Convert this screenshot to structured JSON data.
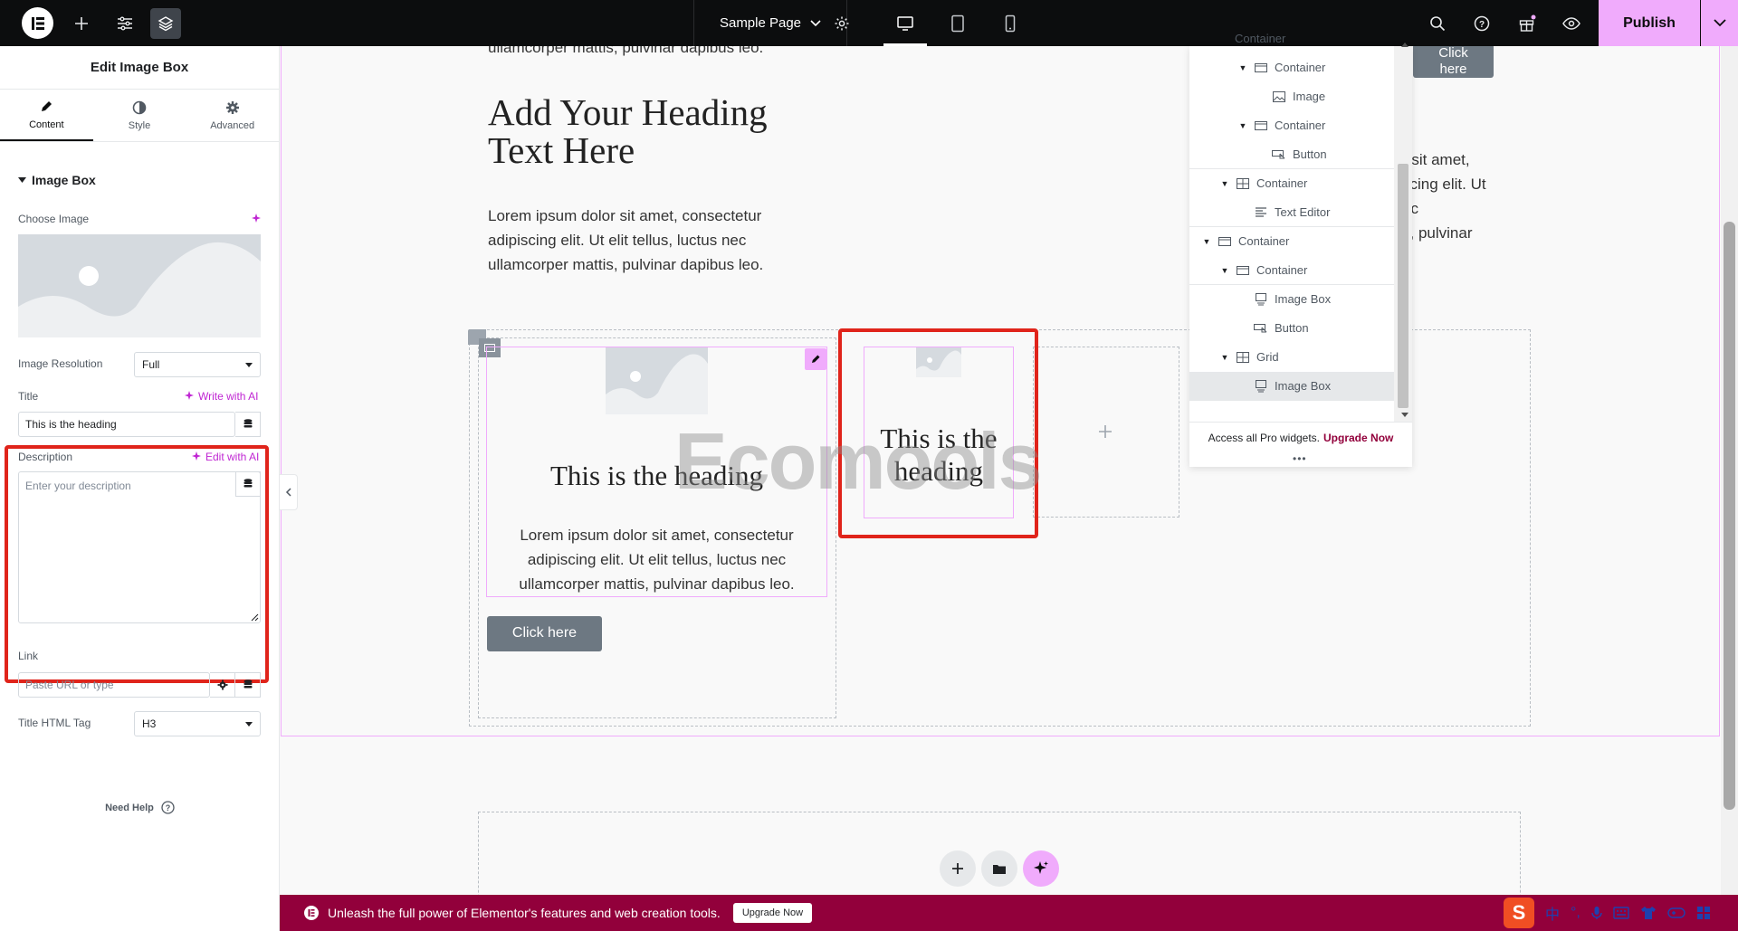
{
  "topbar": {
    "page_title": "Sample Page",
    "publish_label": "Publish"
  },
  "panel": {
    "title": "Edit Image Box",
    "tabs": [
      {
        "label": "Content",
        "icon": "pencil-icon",
        "active": true
      },
      {
        "label": "Style",
        "icon": "contrast-icon",
        "active": false
      },
      {
        "label": "Advanced",
        "icon": "gear-icon",
        "active": false
      }
    ],
    "section_title": "Image Box",
    "choose_image_label": "Choose Image",
    "image_resolution_label": "Image Resolution",
    "image_resolution_value": "Full",
    "title_label": "Title",
    "write_ai_label": "Write with AI",
    "title_value": "This is the heading",
    "description_label": "Description",
    "edit_ai_label": "Edit with AI",
    "description_placeholder": "Enter your description",
    "link_label": "Link",
    "link_placeholder": "Paste URL or type",
    "title_tag_label": "Title HTML Tag",
    "title_tag_value": "H3",
    "need_help_label": "Need Help"
  },
  "canvas": {
    "top_partial_text": "ullamcorper mattis, pulvinar dapibus leo.",
    "heading": "Add Your Heading Text Here",
    "heading_line1": "Add Your Heading",
    "heading_line2": "Text Here",
    "paragraph_lines": [
      "Lorem ipsum dolor sit amet, consectetur",
      "adipiscing elit. Ut elit tellus, luctus nec",
      "ullamcorper mattis, pulvinar dapibus leo."
    ],
    "right_paragraph_lines": [
      "r sit amet,",
      "scing elit. Ut",
      "ec",
      "s, pulvinar"
    ],
    "top_button": "Click here",
    "top_button_line1": "Click",
    "top_button_line2": "here",
    "image_box_1": {
      "title": "This is the heading",
      "description_lines": [
        "Lorem ipsum dolor sit amet, consectetur",
        "adipiscing elit. Ut elit tellus, luctus nec",
        "ullamcorper mattis, pulvinar dapibus leo."
      ]
    },
    "button": "Click here",
    "image_box_2": {
      "title_line1": "This is the",
      "title_line2": "heading"
    },
    "add_icon": "plus-icon",
    "watermark": "Ecomools"
  },
  "navigator": {
    "items": [
      {
        "label": "Container",
        "level": 2,
        "caret": true,
        "icon": "container-icon"
      },
      {
        "label": "Container",
        "level": 3,
        "caret": true,
        "icon": "container-icon"
      },
      {
        "label": "Image",
        "level": 4,
        "caret": false,
        "icon": "image-icon"
      },
      {
        "label": "Container",
        "level": 3,
        "caret": true,
        "icon": "container-icon"
      },
      {
        "label": "Button",
        "level": 4,
        "caret": false,
        "icon": "button-icon"
      },
      {
        "label": "Container",
        "level": 2,
        "caret": true,
        "icon": "grid-icon"
      },
      {
        "label": "Text Editor",
        "level": 3,
        "caret": false,
        "icon": "text-editor-icon"
      },
      {
        "label": "Container",
        "level": 1,
        "caret": true,
        "icon": "container-icon"
      },
      {
        "label": "Container",
        "level": 2,
        "caret": true,
        "icon": "container-icon"
      },
      {
        "label": "Image Box",
        "level": 3,
        "caret": false,
        "icon": "image-box-icon"
      },
      {
        "label": "Button",
        "level": 3,
        "caret": false,
        "icon": "button-icon"
      },
      {
        "label": "Grid",
        "level": 2,
        "caret": true,
        "icon": "grid-icon"
      },
      {
        "label": "Image Box",
        "level": 3,
        "caret": false,
        "icon": "image-box-icon",
        "selected": true
      }
    ],
    "footer_text": "Access all Pro widgets.",
    "footer_link": "Upgrade Now"
  },
  "banner": {
    "text": "Unleash the full power of Elementor's features and web creation tools.",
    "button": "Upgrade Now"
  },
  "tray": {
    "items": [
      "中",
      "°,",
      "mic-icon",
      "keyboard-icon",
      "shirt-icon",
      "gamepad-icon",
      "grid-icon"
    ]
  },
  "colors": {
    "accent": "#f0abfc",
    "highlight": "#e0241b",
    "banner": "#92003b",
    "ai_link": "#c026d3"
  }
}
